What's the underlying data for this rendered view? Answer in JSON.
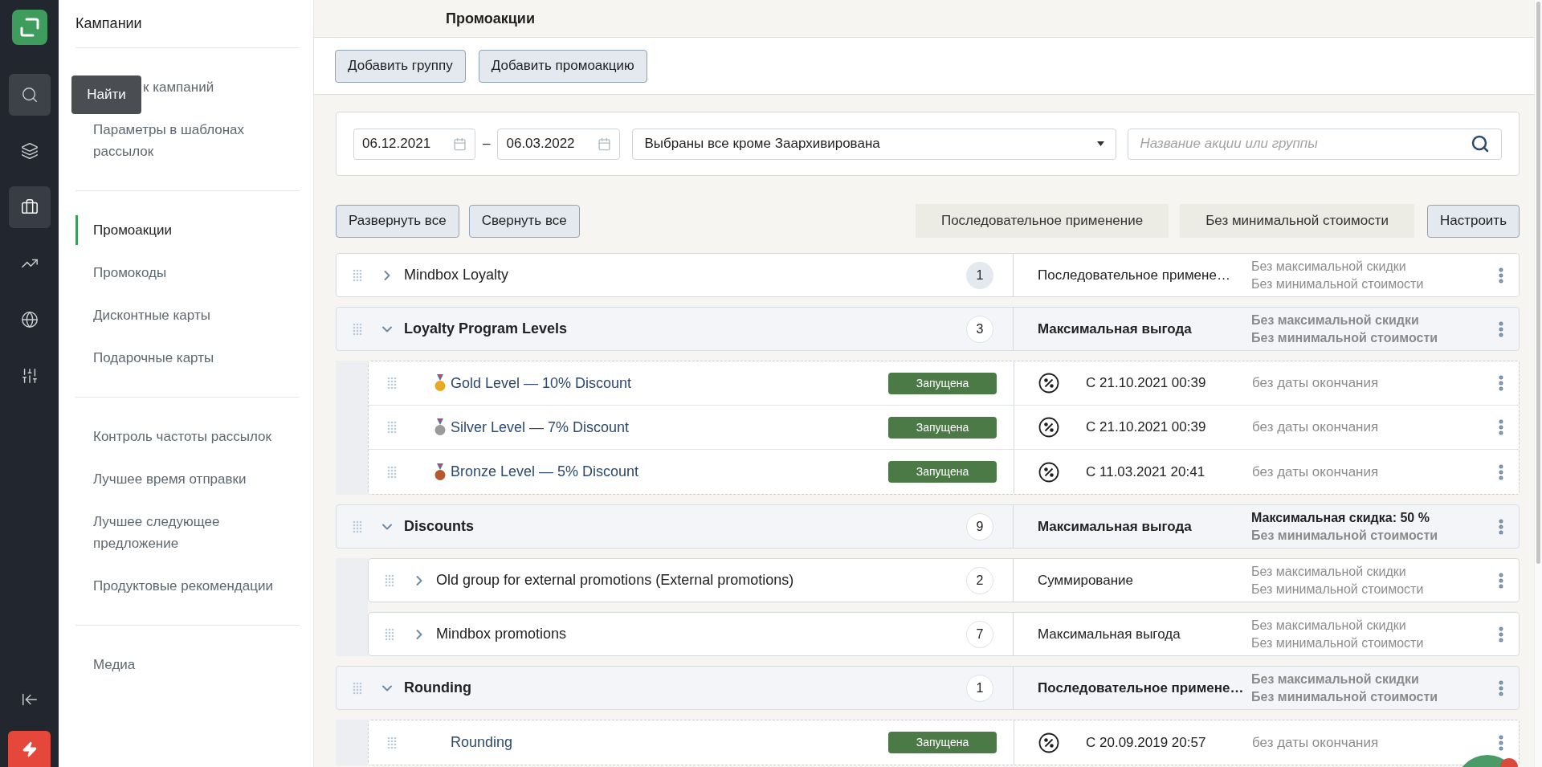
{
  "rail": {
    "items": [
      {
        "selected": false,
        "hovered": true,
        "tooltip": "Найти"
      },
      {
        "selected": false,
        "hovered": false
      },
      {
        "selected": true,
        "hovered": false
      },
      {
        "selected": false,
        "hovered": false
      },
      {
        "selected": false,
        "hovered": false
      },
      {
        "selected": false,
        "hovered": false
      }
    ]
  },
  "sidebar": {
    "title": "Кампании",
    "groups": [
      [
        {
          "kind": "covered",
          "label": "к кампаний",
          "selected": false
        },
        {
          "kind": "link",
          "label": "Параметры в шаблонах\nрассылок",
          "selected": false
        }
      ],
      [
        {
          "kind": "link",
          "label": "Промоакции",
          "selected": true
        },
        {
          "kind": "link",
          "label": "Промокоды",
          "selected": false
        },
        {
          "kind": "link",
          "label": "Дисконтные карты",
          "selected": false
        },
        {
          "kind": "link",
          "label": "Подарочные карты",
          "selected": false
        }
      ],
      [
        {
          "kind": "link",
          "label": "Контроль частоты рассылок",
          "selected": false
        },
        {
          "kind": "link",
          "label": "Лучшее время отправки",
          "selected": false
        },
        {
          "kind": "link",
          "label": "Лучшее следующее\nпредложение",
          "selected": false
        },
        {
          "kind": "link",
          "label": "Продуктовые рекомендации",
          "selected": false
        }
      ],
      [
        {
          "kind": "link",
          "label": "Медиа",
          "selected": false
        }
      ]
    ]
  },
  "page_title": "Промоакции",
  "toolbar": {
    "buttons": [
      "Добавить группу",
      "Добавить промоакцию"
    ]
  },
  "filters": {
    "date_from": "06.12.2021",
    "separator": "–",
    "date_to": "06.03.2022",
    "status": "Выбраны все кроме Заархивирована",
    "search": {
      "placeholder": "Название акции или группы"
    }
  },
  "actions": {
    "buttons": [
      "Развернуть все",
      "Свернуть все"
    ],
    "tags": [
      "Последовательное применение",
      "Без минимальной стоимости"
    ],
    "settings_button": "Настроить"
  },
  "rows": [
    {
      "kind": "group",
      "title": "Mindbox Loyalty",
      "count": "1",
      "count_highlighted": true,
      "expanded": false,
      "strategy": "Последовательное примене…",
      "limits": [
        {
          "text": "Без максимальной скидки",
          "active": false
        },
        {
          "text": "Без минимальной стоимости",
          "active": false
        }
      ]
    },
    {
      "kind": "group",
      "title": "Loyalty Program Levels",
      "count": "3",
      "count_highlighted": false,
      "expanded": true,
      "strategy": "Максимальная выгода",
      "limits": [
        {
          "text": "Без максимальной скидки",
          "active": false
        },
        {
          "text": "Без минимальной стоимости",
          "active": false
        }
      ],
      "children": [
        {
          "kind": "promotion",
          "color": "#e8a823",
          "title": "Gold Level — 10% Discount",
          "status": "Запущена",
          "start": "С 21.10.2021 00:39",
          "end": "без даты окончания"
        },
        {
          "kind": "promotion",
          "color": "#9b9b9b",
          "title": "Silver Level — 7% Discount",
          "status": "Запущена",
          "start": "С 21.10.2021 00:39",
          "end": "без даты окончания"
        },
        {
          "kind": "promotion",
          "color": "#b4582e",
          "title": "Bronze Level — 5% Discount",
          "status": "Запущена",
          "start": "С 11.03.2021 20:41",
          "end": "без даты окончания"
        }
      ]
    },
    {
      "kind": "group",
      "title": "Discounts",
      "count": "9",
      "count_highlighted": false,
      "expanded": true,
      "strategy": "Максимальная выгода",
      "limits": [
        {
          "text": "Максимальная скидка: 50 %",
          "active": true
        },
        {
          "text": "Без минимальной стоимости",
          "active": false
        }
      ],
      "children": [
        {
          "kind": "group",
          "title": "Old group for external promotions (External promotions)",
          "count": "2",
          "count_highlighted": false,
          "expanded": false,
          "strategy": "Суммирование",
          "limits": [
            {
              "text": "Без максимальной скидки",
              "active": false
            },
            {
              "text": "Без минимальной стоимости",
              "active": false
            }
          ]
        },
        {
          "kind": "group",
          "title": "Mindbox promotions",
          "count": "7",
          "count_highlighted": false,
          "expanded": false,
          "strategy": "Максимальная выгода",
          "limits": [
            {
              "text": "Без максимальной скидки",
              "active": false
            },
            {
              "text": "Без минимальной стоимости",
              "active": false
            }
          ]
        }
      ]
    },
    {
      "kind": "group",
      "title": "Rounding",
      "count": "1",
      "count_highlighted": false,
      "expanded": true,
      "strategy": "Последовательное примене…",
      "limits": [
        {
          "text": "Без максимальной скидки",
          "active": false
        },
        {
          "text": "Без минимальной стоимости",
          "active": false
        }
      ],
      "children": [
        {
          "kind": "promotion",
          "title": "Rounding",
          "status": "Запущена",
          "start": "С 20.09.2019 20:57",
          "end": "без даты окончания"
        }
      ]
    }
  ]
}
